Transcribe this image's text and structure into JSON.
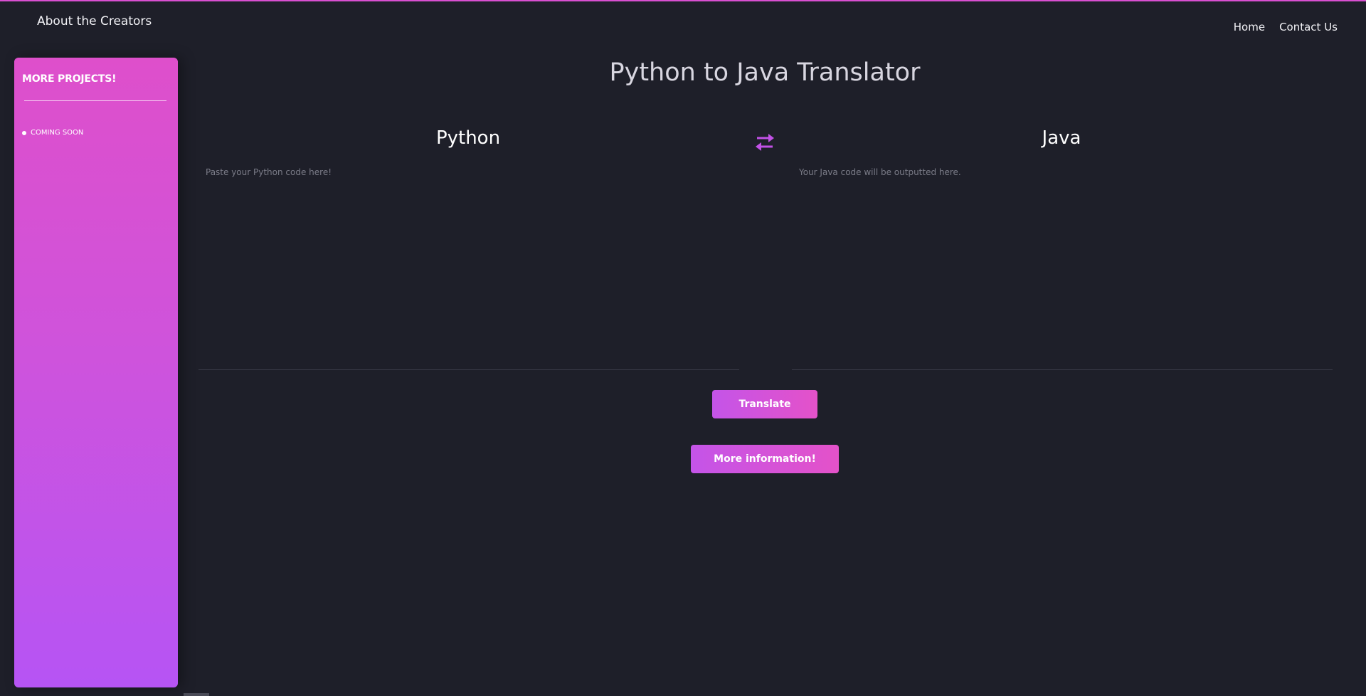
{
  "header": {
    "brand": "About the Creators",
    "nav": [
      "Home",
      "Contact Us"
    ]
  },
  "sidebar": {
    "title": "MORE PROJECTS!",
    "items": [
      "COMING SOON"
    ]
  },
  "main": {
    "title": "Python to Java Translator",
    "left_pane": {
      "heading": "Python",
      "placeholder": "Paste your Python code here!"
    },
    "right_pane": {
      "heading": "Java",
      "placeholder": "Your Java code will be outputted here."
    },
    "translate_label": "Translate",
    "info_label": "More information!"
  },
  "colors": {
    "background": "#1e1f29",
    "accent_pink": "#e452c9",
    "accent_purple": "#b654f4"
  },
  "icons": {
    "swap": "swap-arrows-icon",
    "bullet": "bullet-icon"
  }
}
